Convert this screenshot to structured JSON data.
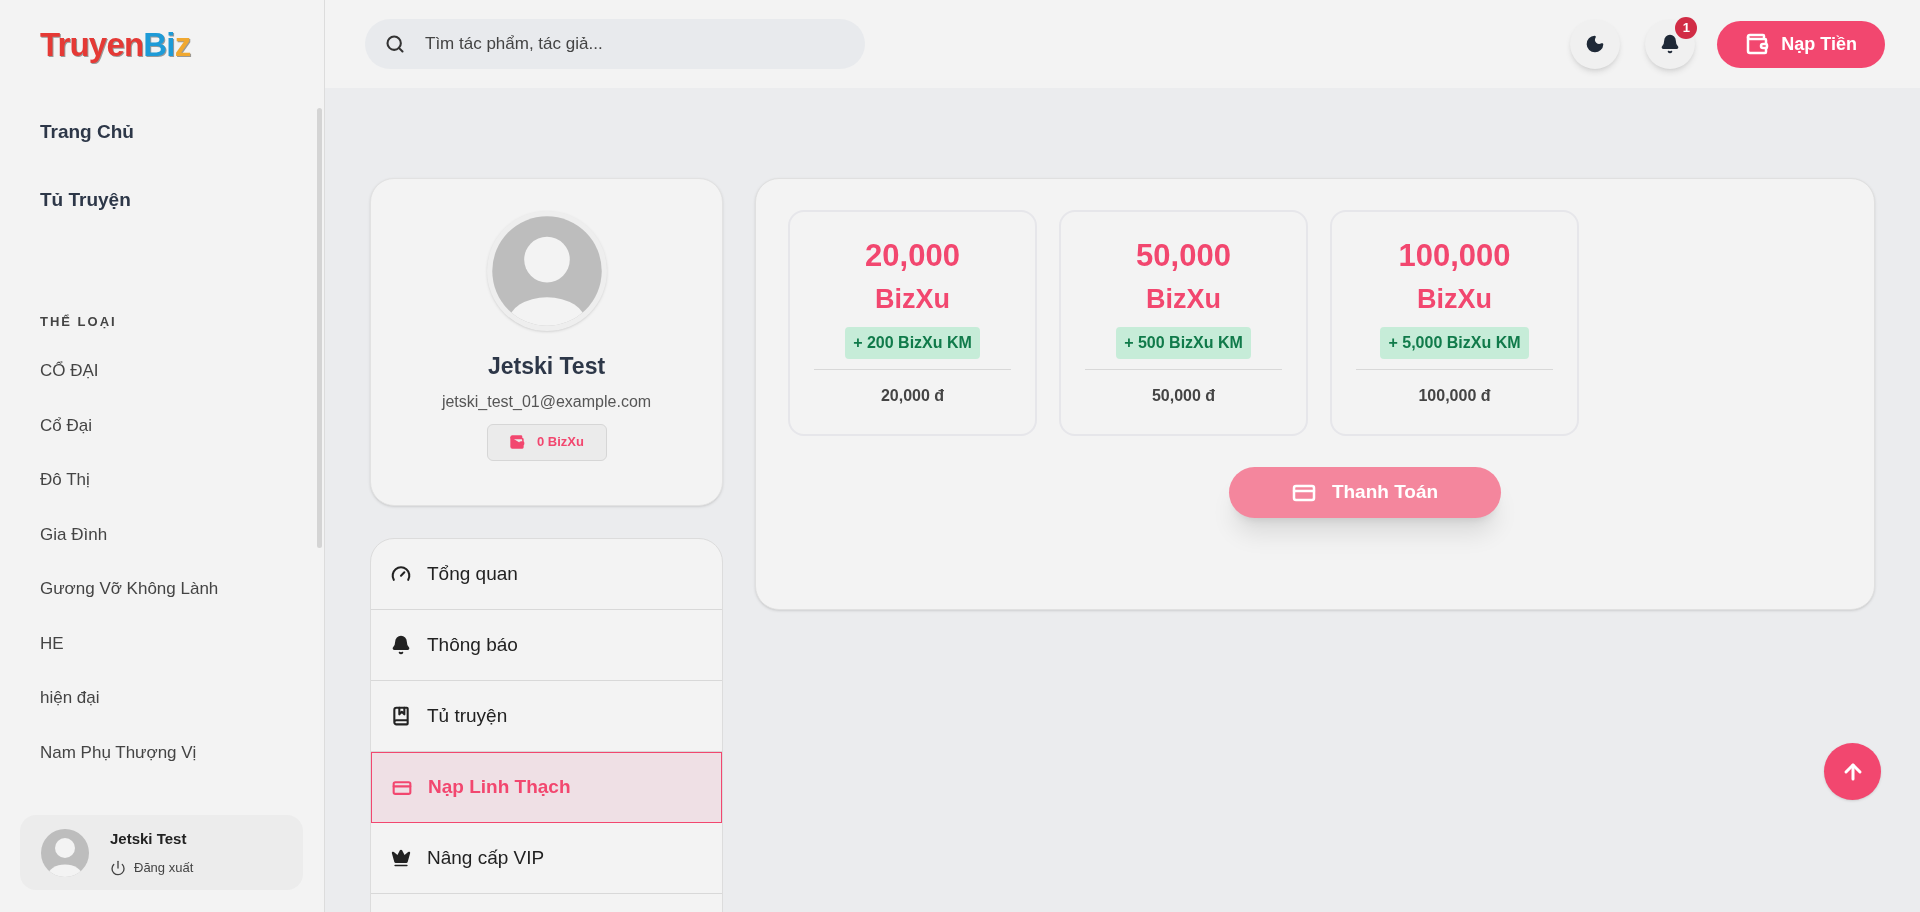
{
  "logo": {
    "parts": [
      {
        "text": "Truyen",
        "color": "#e53935"
      },
      {
        "text": "Bi",
        "color": "#1e9bd7"
      },
      {
        "text": "z",
        "color": "#f0a830"
      }
    ]
  },
  "sidebar": {
    "nav": [
      {
        "label": "Trang Chủ",
        "selected": false
      },
      {
        "label": "Tủ Truyện",
        "selected": false
      }
    ],
    "genres_title": "THỂ LOẠI",
    "genres": [
      "CỔ ĐẠI",
      "Cổ Đại",
      "Đô Thị",
      "Gia Đình",
      "Gương Vỡ Không Lành",
      "HE",
      "hiện đại",
      "Nam Phụ Thượng Vị"
    ],
    "user": {
      "name": "Jetski Test",
      "logout": "Đăng xuất"
    }
  },
  "header": {
    "search": {
      "placeholder": "Tìm tác phẩm, tác giả..."
    },
    "notification_count": "1",
    "topup_button": "Nạp Tiền"
  },
  "profile": {
    "name": "Jetski Test",
    "email": "jetski_test_01@example.com",
    "balance": "0 BizXu"
  },
  "menu": [
    {
      "kind": "gauge",
      "label": "Tổng quan",
      "selected": false
    },
    {
      "kind": "bell",
      "label": "Thông báo",
      "selected": false
    },
    {
      "kind": "book",
      "label": "Tủ truyện",
      "selected": false
    },
    {
      "kind": "card",
      "label": "Nạp Linh Thạch",
      "selected": true
    },
    {
      "kind": "crown",
      "label": "Nâng cấp VIP",
      "selected": false
    }
  ],
  "packages": [
    {
      "amount": "20,000",
      "unit": "BizXu",
      "bonus": "+ 200 BizXu KM",
      "price": "20,000 đ",
      "selected": false
    },
    {
      "amount": "50,000",
      "unit": "BizXu",
      "bonus": "+ 500 BizXu KM",
      "price": "50,000 đ",
      "selected": false
    },
    {
      "amount": "100,000",
      "unit": "BizXu",
      "bonus": "+ 5,000 BizXu KM",
      "price": "100,000 đ",
      "selected": false
    }
  ],
  "pay_button": {
    "label": "Thanh Toán",
    "disabled": true
  }
}
